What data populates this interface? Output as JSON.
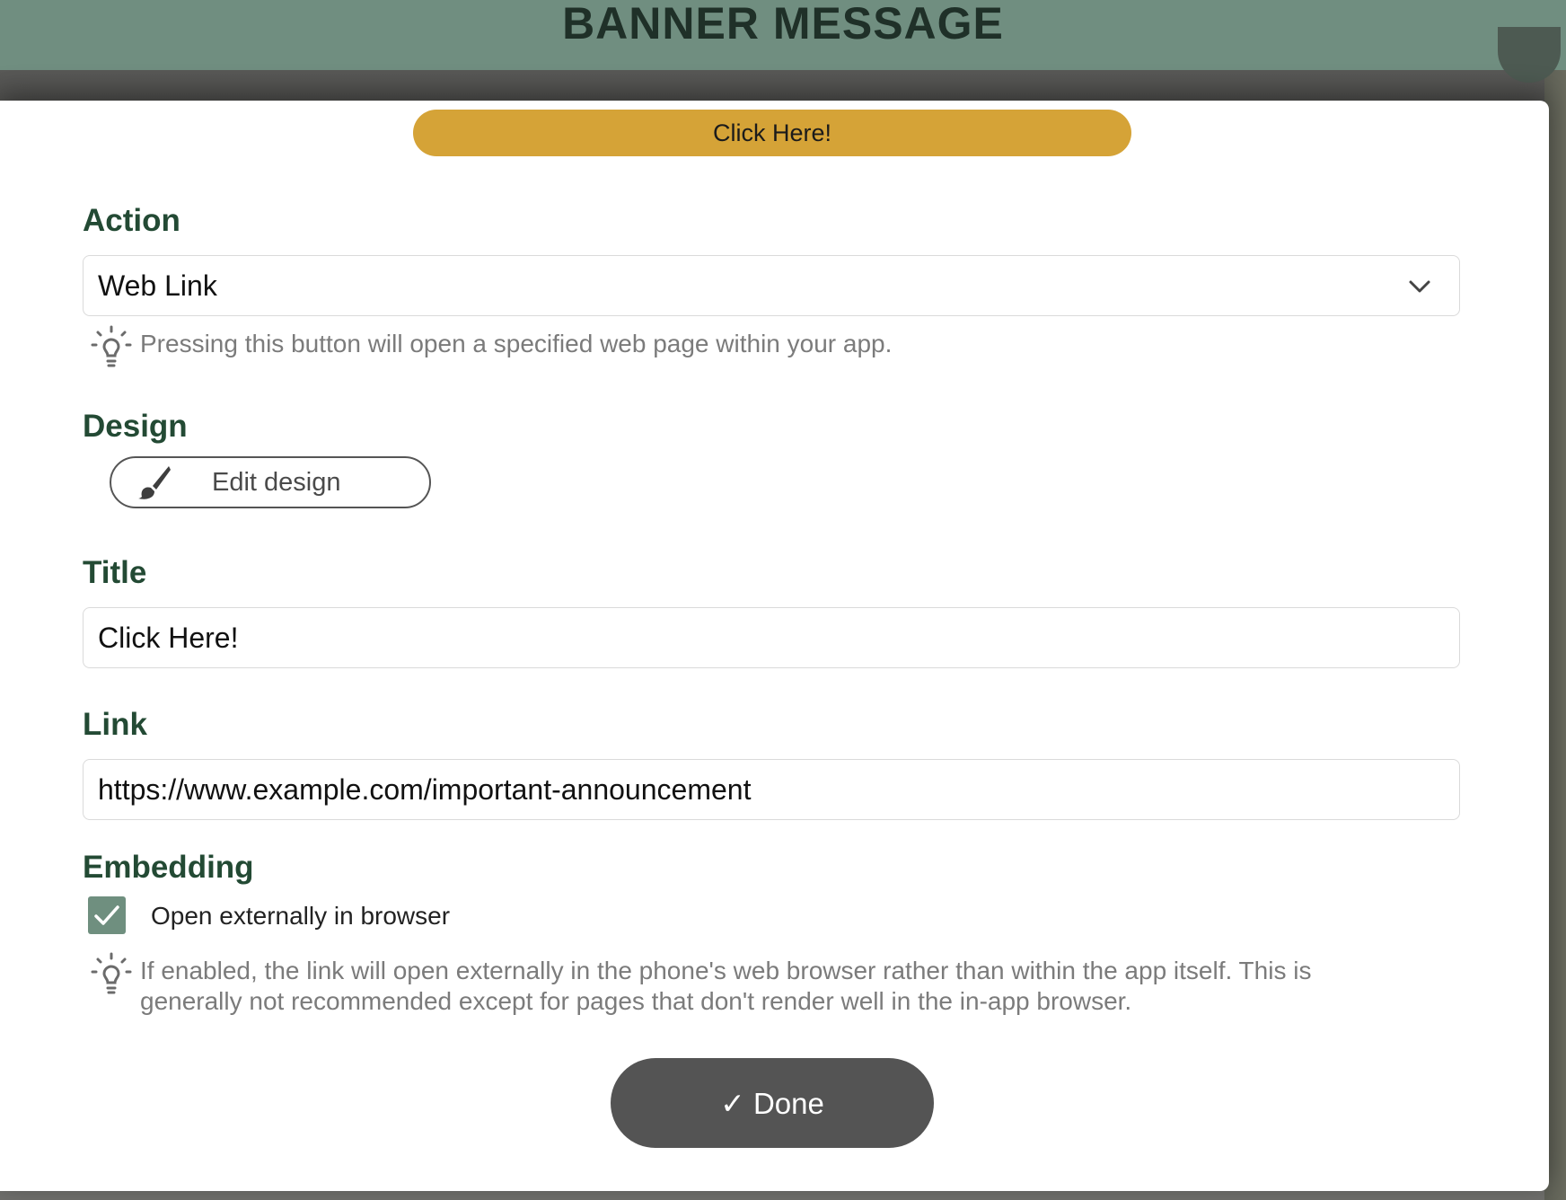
{
  "header": {
    "title": "BANNER MESSAGE"
  },
  "preview": {
    "button_label": "Click Here!"
  },
  "action": {
    "label": "Action",
    "selected": "Web Link",
    "hint": "Pressing this button will open a specified web page within your app."
  },
  "design": {
    "label": "Design",
    "edit_button": "Edit design"
  },
  "title_field": {
    "label": "Title",
    "value": "Click Here!"
  },
  "link_field": {
    "label": "Link",
    "value": "https://www.example.com/important-announcement"
  },
  "embedding": {
    "label": "Embedding",
    "checkbox_label": "Open externally in browser",
    "checked": true,
    "hint_line1": "If enabled, the link will open externally in the phone's web browser rather than within the app itself. This is",
    "hint_line2": "generally not recommended except for pages that don't render well in the in-app browser."
  },
  "done": {
    "label": "✓ Done"
  },
  "colors": {
    "header_bg": "#708e80",
    "accent": "#d5a337",
    "label": "#234a34",
    "checkbox": "#6f8f7f",
    "done_bg": "#545454"
  }
}
